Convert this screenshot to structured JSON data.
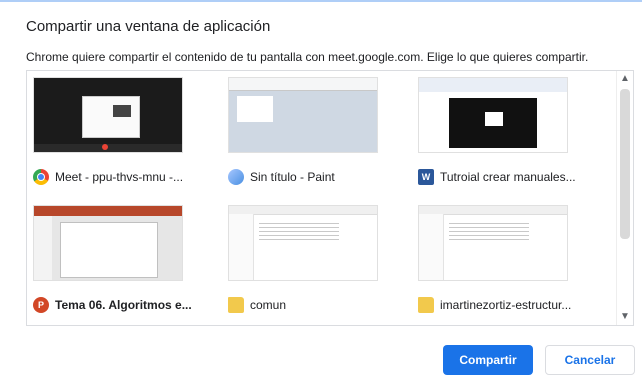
{
  "dialog": {
    "title": "Compartir una ventana de aplicación",
    "subtitle": "Chrome quiere compartir el contenido de tu pantalla con meet.google.com. Elige lo que quieres compartir."
  },
  "windows": [
    {
      "label": "Meet - ppu-thvs-mnu -...",
      "icon": "chrome-icon"
    },
    {
      "label": "Sin título - Paint",
      "icon": "paint-icon"
    },
    {
      "label": "Tutroial crear manuales...",
      "icon": "word-icon"
    },
    {
      "label": "Tema 06. Algoritmos e...",
      "icon": "powerpoint-icon",
      "selected": true
    },
    {
      "label": "comun",
      "icon": "folder-icon"
    },
    {
      "label": "imartinezortiz-estructur...",
      "icon": "folder-icon"
    }
  ],
  "buttons": {
    "share": "Compartir",
    "cancel": "Cancelar"
  },
  "colors": {
    "accent": "#1a73e8"
  }
}
